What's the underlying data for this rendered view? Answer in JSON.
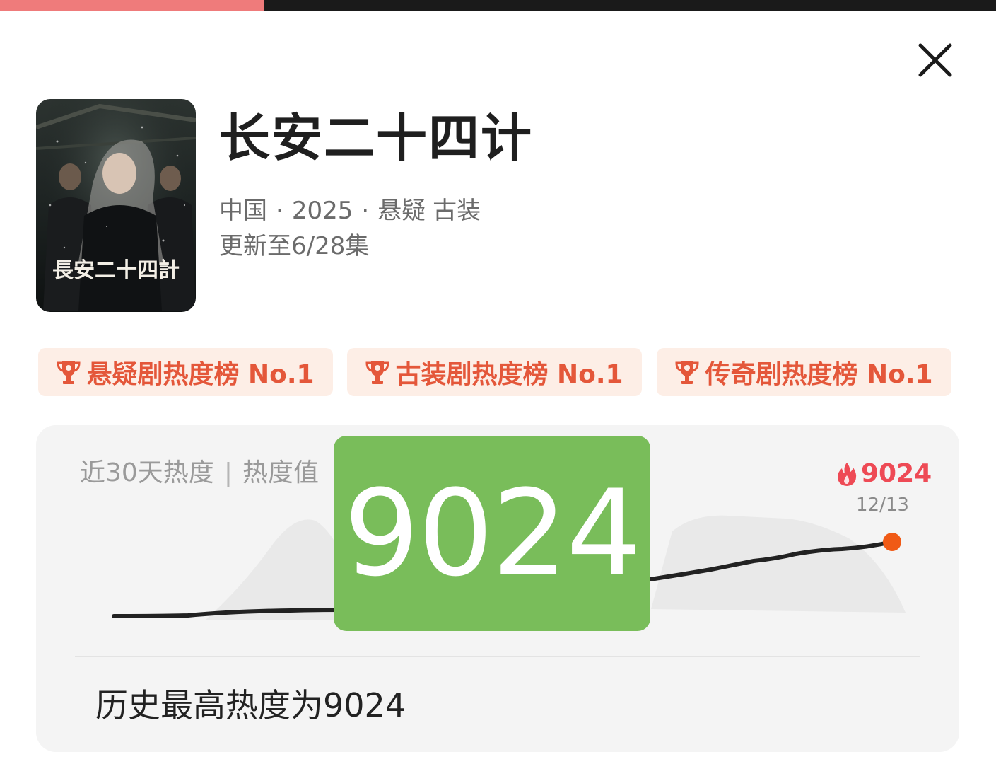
{
  "progress": {
    "fraction": 0.265,
    "color": "#ef7b7b"
  },
  "show": {
    "title": "长安二十四计",
    "region": "中国",
    "year": "2025",
    "genres": [
      "悬疑",
      "古装"
    ],
    "separator": "·",
    "update_status": "更新至6/28集",
    "poster_text": "長安二十四計"
  },
  "badges": [
    {
      "label": "悬疑剧热度榜 No.1",
      "icon": "trophy-icon"
    },
    {
      "label": "古装剧热度榜 No.1",
      "icon": "trophy-icon"
    },
    {
      "label": "传奇剧热度榜 No.1",
      "icon": "trophy-icon"
    }
  ],
  "heat": {
    "header_left": "近30天热度",
    "header_sep": "|",
    "header_right": "热度值",
    "peak_value": "9024",
    "peak_date": "12/13",
    "record_text": "历史最高热度为9024",
    "overlay_value": "9024",
    "colors": {
      "line": "#222222",
      "endpoint": "#f05a16",
      "peak": "#ee4a55",
      "overlay": "#79bd5a"
    }
  },
  "icons": {
    "close": "close-icon",
    "flame": "flame-icon",
    "trophy": "trophy-icon"
  }
}
